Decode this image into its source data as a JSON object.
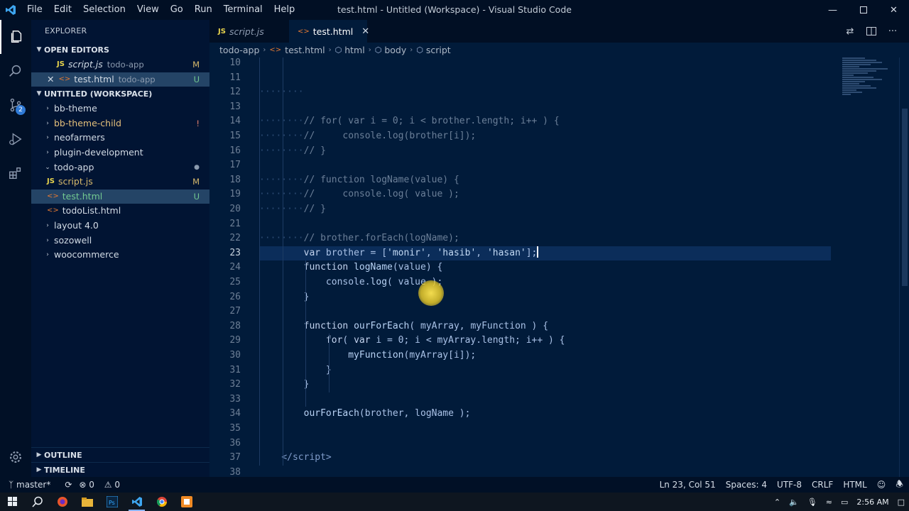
{
  "titlebar": {
    "menu": [
      "File",
      "Edit",
      "Selection",
      "View",
      "Go",
      "Run",
      "Terminal",
      "Help"
    ],
    "window_title": "test.html - Untitled (Workspace) - Visual Studio Code"
  },
  "sidebar": {
    "header": "EXPLORER",
    "open_editors_title": "OPEN EDITORS",
    "open_editors": [
      {
        "name": "script.js",
        "folder": "todo-app",
        "status": "M",
        "type": "js"
      },
      {
        "name": "test.html",
        "folder": "todo-app",
        "status": "U",
        "type": "html"
      }
    ],
    "workspace_title": "UNTITLED (WORKSPACE)",
    "tree": [
      {
        "label": "bb-theme",
        "kind": "folder",
        "open": false,
        "status": ""
      },
      {
        "label": "bb-theme-child",
        "kind": "folder",
        "open": false,
        "status": "!"
      },
      {
        "label": "neofarmers",
        "kind": "folder",
        "open": false,
        "status": ""
      },
      {
        "label": "plugin-development",
        "kind": "folder",
        "open": false,
        "status": ""
      },
      {
        "label": "todo-app",
        "kind": "folder",
        "open": true,
        "status": "●"
      },
      {
        "label": "script.js",
        "kind": "js",
        "status": "M"
      },
      {
        "label": "test.html",
        "kind": "html",
        "status": "U"
      },
      {
        "label": "todoList.html",
        "kind": "html",
        "status": ""
      },
      {
        "label": "layout 4.0",
        "kind": "folder",
        "open": false,
        "status": ""
      },
      {
        "label": "sozowell",
        "kind": "folder",
        "open": false,
        "status": ""
      },
      {
        "label": "woocommerce",
        "kind": "folder",
        "open": false,
        "status": ""
      }
    ],
    "outline_title": "OUTLINE",
    "timeline_title": "TIMELINE"
  },
  "tabs": [
    {
      "label": "script.js",
      "type": "js",
      "active": false
    },
    {
      "label": "test.html",
      "type": "html",
      "active": true
    }
  ],
  "breadcrumb": [
    "todo-app",
    "test.html",
    "html",
    "body",
    "script"
  ],
  "editor": {
    "lines": [
      {
        "n": "10",
        "html": ""
      },
      {
        "n": "11",
        "html": ""
      },
      {
        "n": "12",
        "html": "<span class='ws'>········</span>"
      },
      {
        "n": "13",
        "html": ""
      },
      {
        "n": "14",
        "html": "<span class='ws'>········</span><span class='c-com'>// for( var i = 0; i < brother.length; i++ ) {</span>"
      },
      {
        "n": "15",
        "html": "<span class='ws'>········</span><span class='c-com'>//     console.log(brother[i]);</span>"
      },
      {
        "n": "16",
        "html": "<span class='ws'>········</span><span class='c-com'>// }</span>"
      },
      {
        "n": "17",
        "html": ""
      },
      {
        "n": "18",
        "html": "<span class='ws'>········</span><span class='c-com'>// function logName(value) {</span>"
      },
      {
        "n": "19",
        "html": "<span class='ws'>········</span><span class='c-com'>//     console.log( value );</span>"
      },
      {
        "n": "20",
        "html": "<span class='ws'>········</span><span class='c-com'>// }</span>"
      },
      {
        "n": "21",
        "html": ""
      },
      {
        "n": "22",
        "html": "<span class='ws'>········</span><span class='c-com'>// brother.forEach(logName);</span>"
      },
      {
        "n": "23",
        "html": "        <span class='c-kw'>var</span> brother = [<span class='c-str'>'monir'</span>, <span class='c-str'>'hasib'</span>, <span class='c-str'>'hasan'</span>];<span class='caret'></span>",
        "current": true
      },
      {
        "n": "24",
        "html": "        <span class='c-kw'>function</span> <span class='c-fn'>logName</span>(value) {"
      },
      {
        "n": "25",
        "html": "            console.<span class='c-fn'>log</span>( value );"
      },
      {
        "n": "26",
        "html": "        }"
      },
      {
        "n": "27",
        "html": ""
      },
      {
        "n": "28",
        "html": "        <span class='c-kw'>function</span> <span class='c-fn'>ourForEach</span>( myArray, myFunction ) {"
      },
      {
        "n": "29",
        "html": "            <span class='c-kw'>for</span>( <span class='c-kw'>var</span> i = 0; i < myArray.length; i++ ) {"
      },
      {
        "n": "30",
        "html": "                <span class='c-fn'>myFunction</span>(myArray[i]);"
      },
      {
        "n": "31",
        "html": "            }"
      },
      {
        "n": "32",
        "html": "        }"
      },
      {
        "n": "33",
        "html": ""
      },
      {
        "n": "34",
        "html": "        <span class='c-fn'>ourForEach</span>(brother, logName );"
      },
      {
        "n": "35",
        "html": ""
      },
      {
        "n": "36",
        "html": ""
      },
      {
        "n": "37",
        "html": "    <span class='c-tag'>&lt;/script&gt;</span>"
      },
      {
        "n": "38",
        "html": ""
      }
    ]
  },
  "statusbar": {
    "branch": "master*",
    "problems": "0",
    "warnings": "0",
    "position": "Ln 23, Col 51",
    "spaces": "Spaces: 4",
    "encoding": "UTF-8",
    "eol": "CRLF",
    "language": "HTML"
  },
  "taskbar": {
    "time": "2:56 AM"
  },
  "colors": {
    "accent": "#2f7ad6",
    "modified": "#d7b96b",
    "untracked": "#73c991"
  }
}
